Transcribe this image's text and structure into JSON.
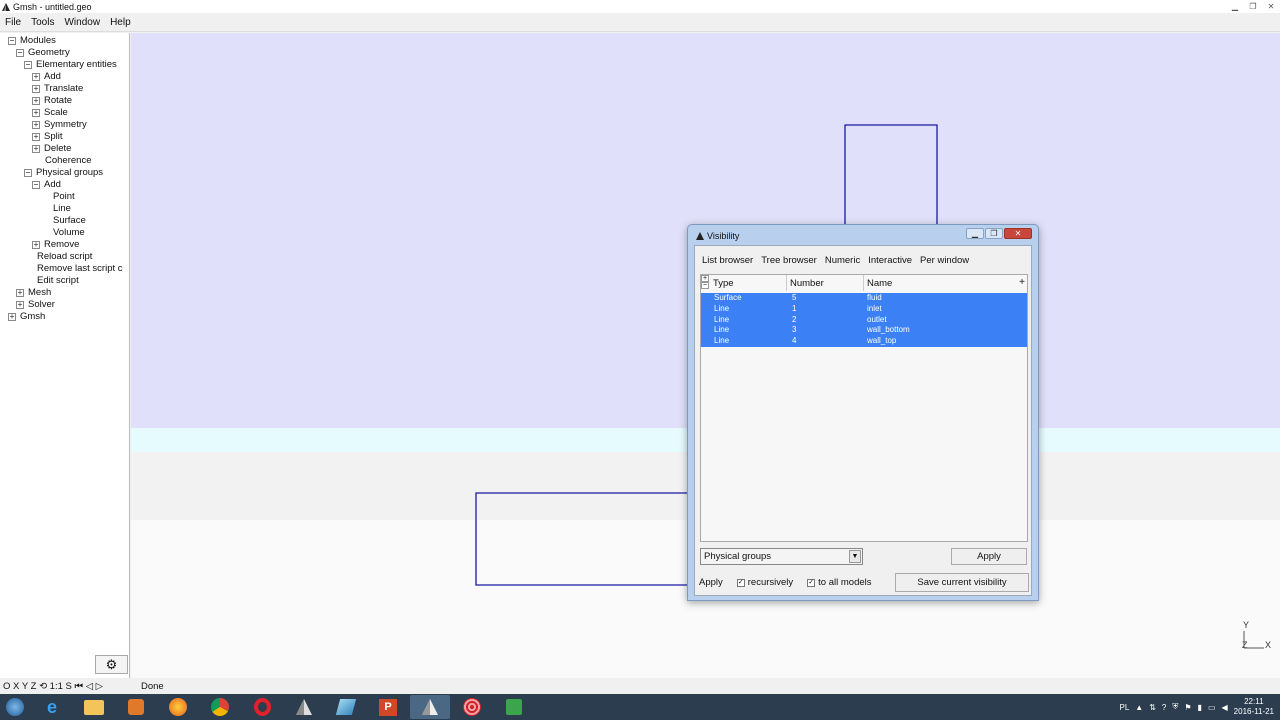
{
  "window": {
    "title": "Gmsh - untitled.geo"
  },
  "menu": [
    {
      "label": "File"
    },
    {
      "label": "Tools"
    },
    {
      "label": "Window"
    },
    {
      "label": "Help"
    }
  ],
  "tree": [
    {
      "label": "Modules",
      "box": "−"
    },
    {
      "label": "Geometry",
      "box": "−"
    },
    {
      "label": "Elementary entities",
      "box": "−"
    },
    {
      "label": "Add",
      "box": "+"
    },
    {
      "label": "Translate",
      "box": "+"
    },
    {
      "label": "Rotate",
      "box": "+"
    },
    {
      "label": "Scale",
      "box": "+"
    },
    {
      "label": "Symmetry",
      "box": "+"
    },
    {
      "label": "Split",
      "box": "+"
    },
    {
      "label": "Delete",
      "box": "+"
    },
    {
      "label": "Coherence",
      "box": ""
    },
    {
      "label": "Physical groups",
      "box": "−"
    },
    {
      "label": "Add",
      "box": "−"
    },
    {
      "label": "Point",
      "box": ""
    },
    {
      "label": "Line",
      "box": ""
    },
    {
      "label": "Surface",
      "box": ""
    },
    {
      "label": "Volume",
      "box": ""
    },
    {
      "label": "Remove",
      "box": "+"
    },
    {
      "label": "Reload script",
      "box": ""
    },
    {
      "label": "Remove last script c",
      "box": ""
    },
    {
      "label": "Edit script",
      "box": ""
    },
    {
      "label": "Mesh",
      "box": "+"
    },
    {
      "label": "Solver",
      "box": "+"
    },
    {
      "label": "Gmsh",
      "box": "+"
    }
  ],
  "statusbar": {
    "buttons": "O X Y Z ⟲ 1:1 S ⏮ ◁ ▷",
    "status": "Done"
  },
  "axes": {
    "y": "Y",
    "z": "Z",
    "x": "X"
  },
  "visibility": {
    "title": "Visibility",
    "tabs": [
      {
        "label": "List browser"
      },
      {
        "label": "Tree browser"
      },
      {
        "label": "Numeric"
      },
      {
        "label": "Interactive"
      },
      {
        "label": "Per window"
      }
    ],
    "columns": {
      "type": "Type",
      "number": "Number",
      "name": "Name",
      "add": "+"
    },
    "rows": [
      {
        "type": "Surface",
        "number": "5",
        "name": "fluid"
      },
      {
        "type": "Line",
        "number": "1",
        "name": "inlet"
      },
      {
        "type": "Line",
        "number": "2",
        "name": "outlet"
      },
      {
        "type": "Line",
        "number": "3",
        "name": "wall_bottom"
      },
      {
        "type": "Line",
        "number": "4",
        "name": "wall_top"
      }
    ],
    "select_value": "Physical groups",
    "apply_top": "Apply",
    "apply_label": "Apply",
    "recursively": "recursively",
    "to_all_models": "to all models",
    "save_button": "Save current visibility"
  },
  "tray": {
    "lang": "PL",
    "time": "22:11",
    "date": "2016-11-21"
  },
  "colors": {
    "graphic_bg": "#e0e0fa",
    "geometry_line": "#1a1aa6",
    "selection": "#3b81f5"
  }
}
